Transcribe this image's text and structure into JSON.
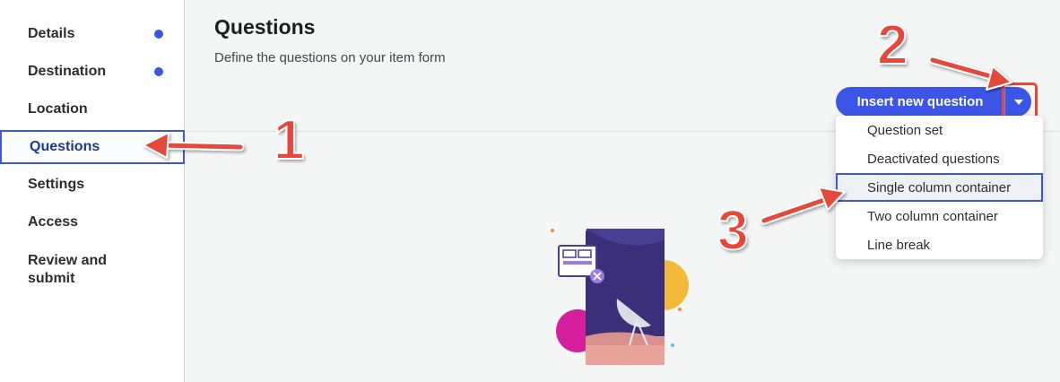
{
  "sidebar": {
    "items": [
      {
        "label": "Details",
        "has_dot": true
      },
      {
        "label": "Destination",
        "has_dot": true
      },
      {
        "label": "Location",
        "has_dot": false
      },
      {
        "label": "Questions",
        "has_dot": false,
        "active": true
      },
      {
        "label": "Settings",
        "has_dot": false
      },
      {
        "label": "Access",
        "has_dot": false
      },
      {
        "label": "Review and submit",
        "has_dot": false
      }
    ]
  },
  "header": {
    "title": "Questions",
    "subtitle": "Define the questions on your item form"
  },
  "insert_button": {
    "label": "Insert new question",
    "toggle_icon": "caret-down-icon"
  },
  "dropdown": {
    "items": [
      {
        "label": "Question set"
      },
      {
        "label": "Deactivated questions"
      },
      {
        "label": "Single column container",
        "selected": true
      },
      {
        "label": "Two column container"
      },
      {
        "label": "Line break"
      }
    ]
  },
  "annotations": {
    "step1": "1",
    "step2": "2",
    "step3": "3"
  },
  "colors": {
    "accent": "#3b55e6",
    "annotation": "#e5483b"
  }
}
